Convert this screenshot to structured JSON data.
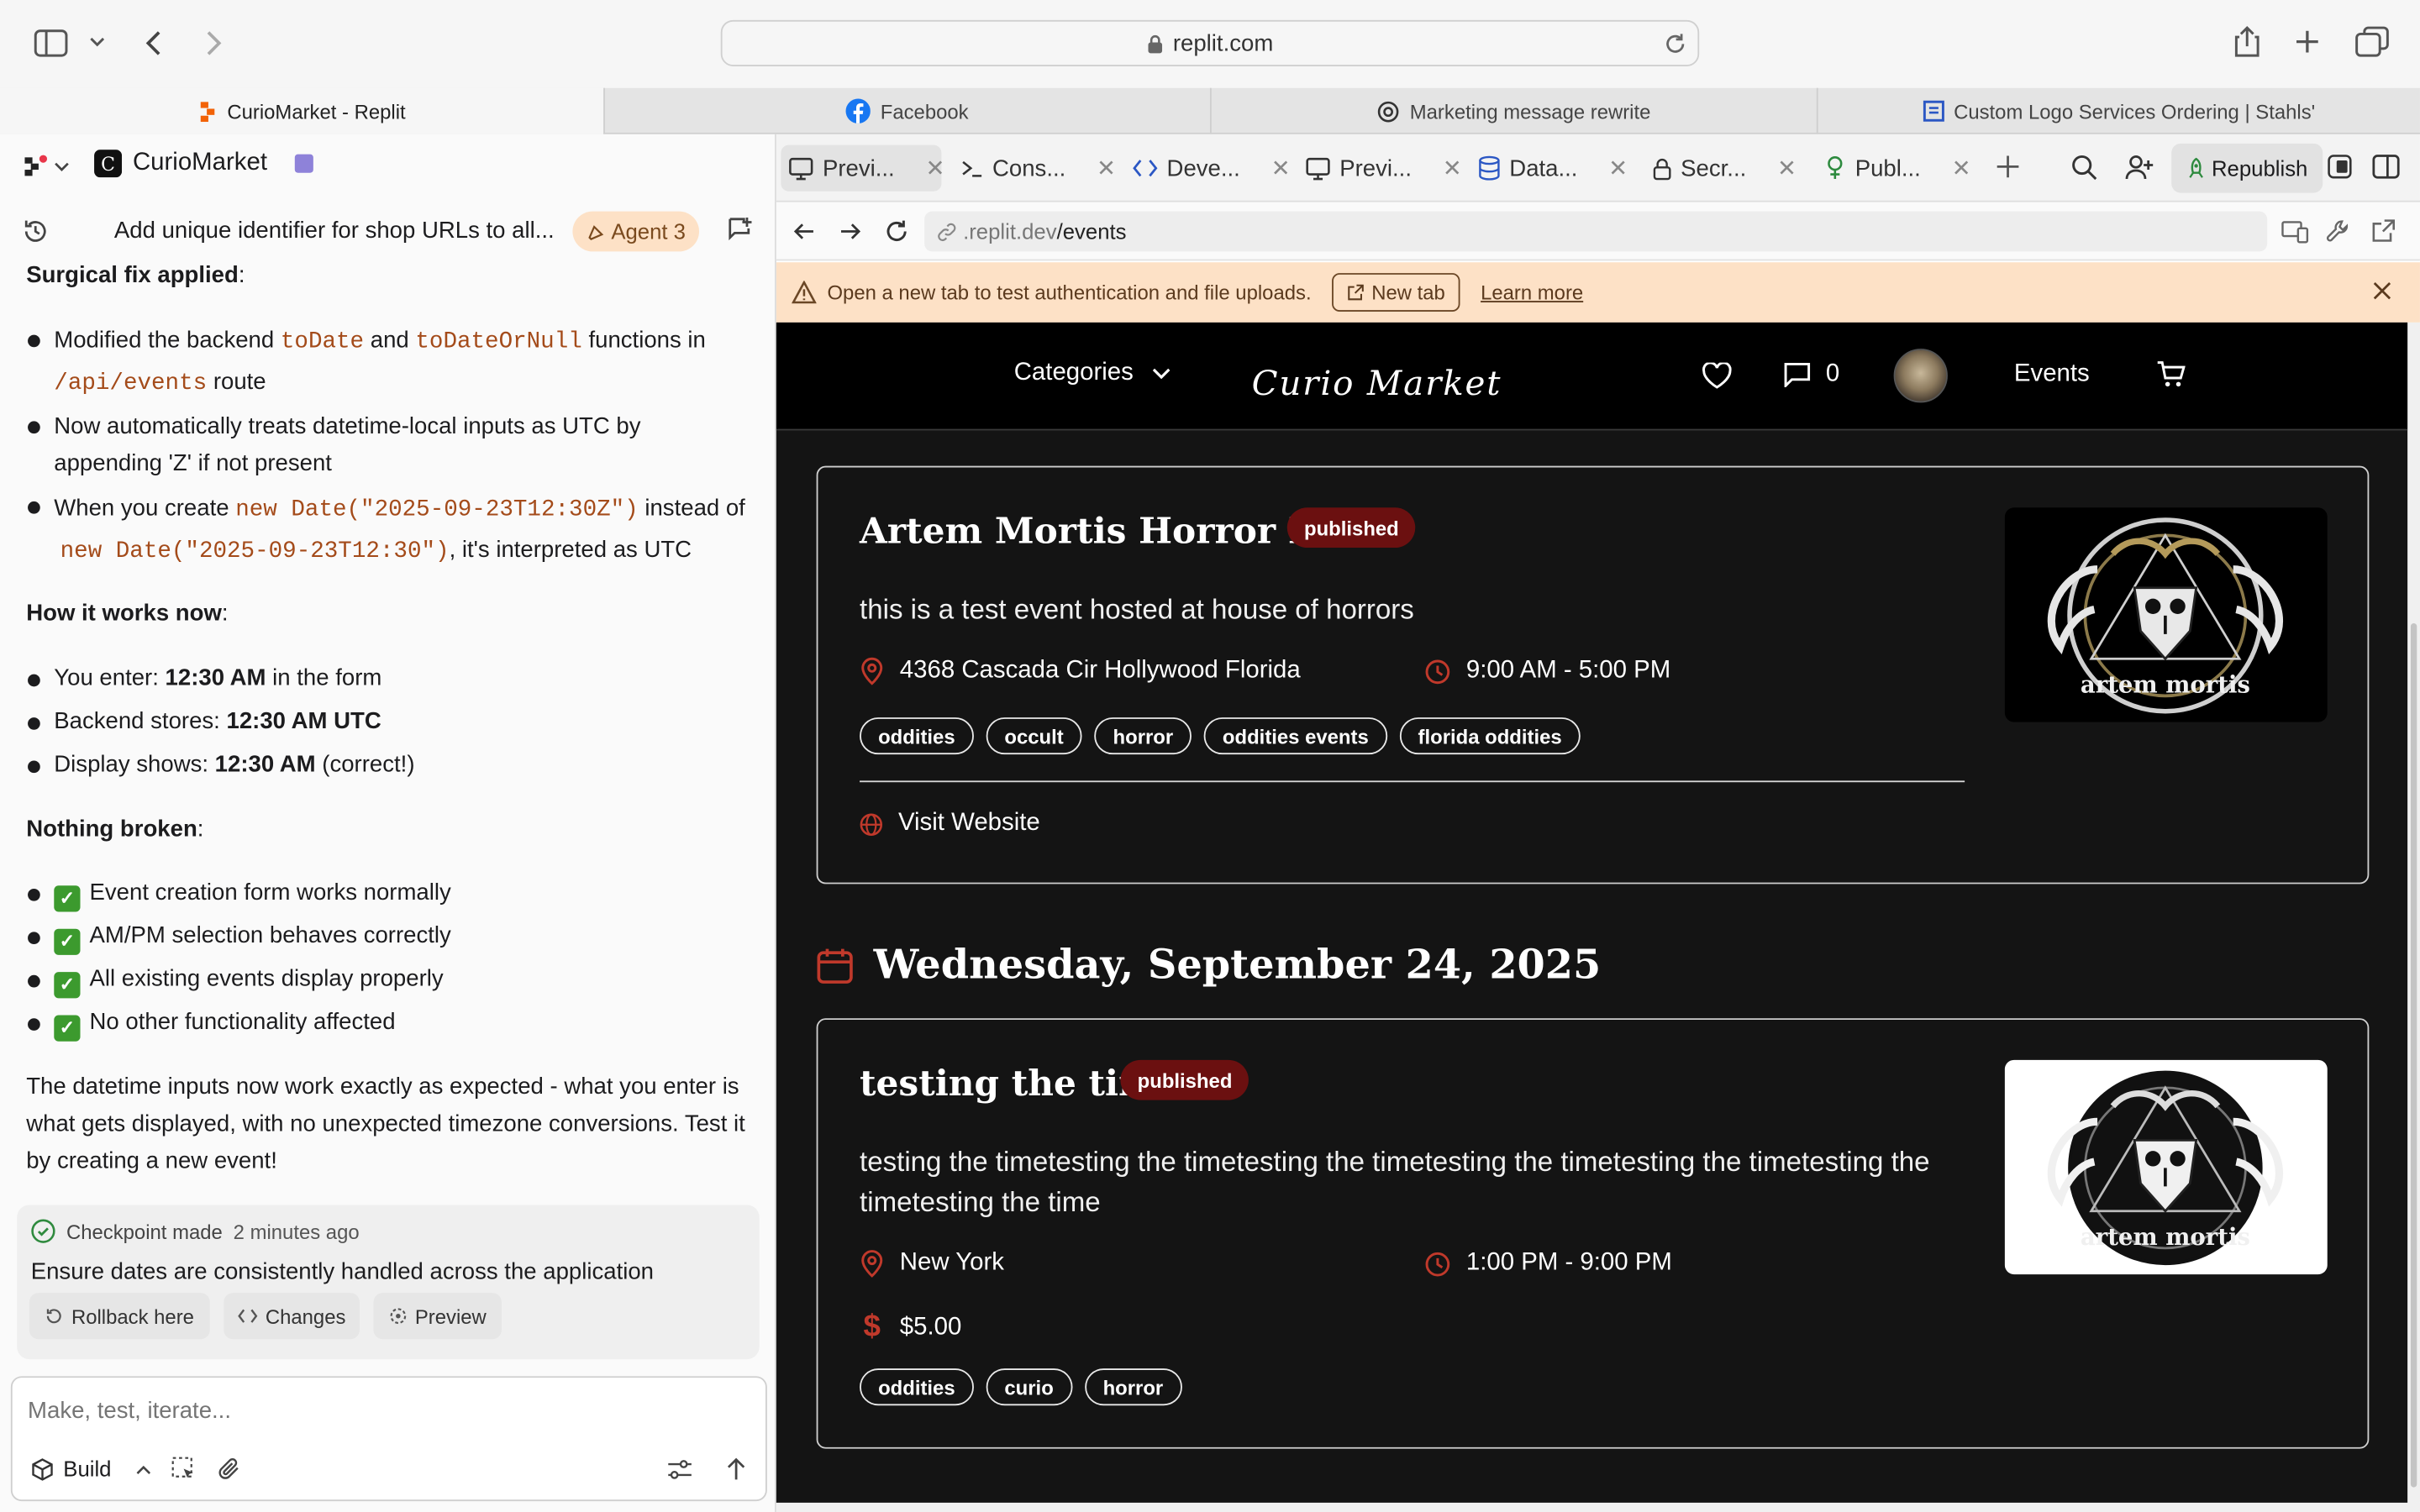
{
  "browser": {
    "url": "replit.com",
    "tabs": [
      {
        "label": "CurioMarket - Replit",
        "active": true
      },
      {
        "label": "Facebook",
        "active": false
      },
      {
        "label": "Marketing message rewrite",
        "active": false
      },
      {
        "label": "Custom Logo Services Ordering | Stahls'",
        "active": false
      }
    ]
  },
  "workspace": {
    "project_name": "CurioMarket",
    "agent_badge": "Agent 3",
    "thread_title": "Add unique identifier for shop URLs to all..."
  },
  "chat": {
    "fix_heading": "Surgical fix applied",
    "fix_items": {
      "b1_a": "Modified the backend",
      "b1_code1": "toDate",
      "b1_and": "and",
      "b1_code2": "toDateOrNull",
      "b1_b": "functions in",
      "b1_code3": "/api/events",
      "b1_c": "route",
      "b2": "Now automatically treats datetime-local inputs as UTC by appending 'Z' if not present",
      "b3_a": "When you create",
      "b3_code1": "new Date(\"2025-09-23T12:30Z\")",
      "b3_b": "instead of",
      "b3_code2": "new Date(\"2025-09-23T12:30\")",
      "b3_c": ", it's interpreted as UTC"
    },
    "how_heading": "How it works now",
    "how_items": [
      {
        "pre": "You enter: ",
        "bold": "12:30 AM",
        "post": " in the form"
      },
      {
        "pre": "Backend stores: ",
        "bold": "12:30 AM UTC",
        "post": ""
      },
      {
        "pre": "Display shows: ",
        "bold": "12:30 AM",
        "post": " (correct!)"
      }
    ],
    "nothing_heading": "Nothing broken",
    "nothing_items": [
      "Event creation form works normally",
      "AM/PM selection behaves correctly",
      "All existing events display properly",
      "No other functionality affected"
    ],
    "summary": "The datetime inputs now work exactly as expected - what you enter is what gets displayed, with no unexpected timezone conversions. Test it by creating a new event!",
    "checkpoint": {
      "label": "Checkpoint made",
      "time": "2 minutes ago",
      "message": "Ensure dates are consistently handled across the application",
      "rollback": "Rollback here",
      "changes": "Changes",
      "preview": "Preview"
    },
    "input_placeholder": "Make, test, iterate...",
    "mode": "Build"
  },
  "pane_tabs": [
    {
      "label": "Previ...",
      "icon": "monitor-icon",
      "active": true
    },
    {
      "label": "Cons...",
      "icon": "terminal-icon",
      "active": false
    },
    {
      "label": "Deve...",
      "icon": "code-icon",
      "active": false
    },
    {
      "label": "Previ...",
      "icon": "monitor-icon",
      "active": false
    },
    {
      "label": "Data...",
      "icon": "database-icon",
      "active": false
    },
    {
      "label": "Secr...",
      "icon": "lock-icon",
      "active": false
    },
    {
      "label": "Publ...",
      "icon": "publish-icon",
      "active": false
    }
  ],
  "republish_label": "Republish",
  "preview": {
    "address_host": ".replit.dev",
    "address_path": "/events",
    "banner_text": "Open a new tab to test authentication and file uploads.",
    "banner_button": "New tab",
    "banner_link": "Learn more"
  },
  "site": {
    "categories_label": "Categories",
    "logo_text": "Curio Market",
    "messages_count": "0",
    "events_label": "Events",
    "date_heading": "Wednesday, September 24, 2025",
    "events": [
      {
        "title": "Artem Mortis Horror Host",
        "status": "published",
        "description": "this is a test event hosted at house of horrors",
        "location": "4368 Cascada Cir Hollywood Florida",
        "time": "9:00 AM - 5:00 PM",
        "tags": [
          "oddities",
          "occult",
          "horror",
          "oddities events",
          "florida oddities"
        ],
        "website_label": "Visit Website",
        "image_text": "artem mortis"
      },
      {
        "title": "testing the time",
        "status": "published",
        "description": "testing the timetesting the timetesting the timetesting the timetesting the timetesting the timetesting the time",
        "location": "New York",
        "time": "1:00 PM - 9:00 PM",
        "price": "$5.00",
        "tags": [
          "oddities",
          "curio",
          "horror"
        ],
        "image_text": "artem mortis"
      }
    ]
  },
  "colors": {
    "accent_red": "#c0392b",
    "badge_red": "#6b1010",
    "agent_badge_bg": "#fde1c6",
    "banner_bg": "#fde1c6"
  }
}
